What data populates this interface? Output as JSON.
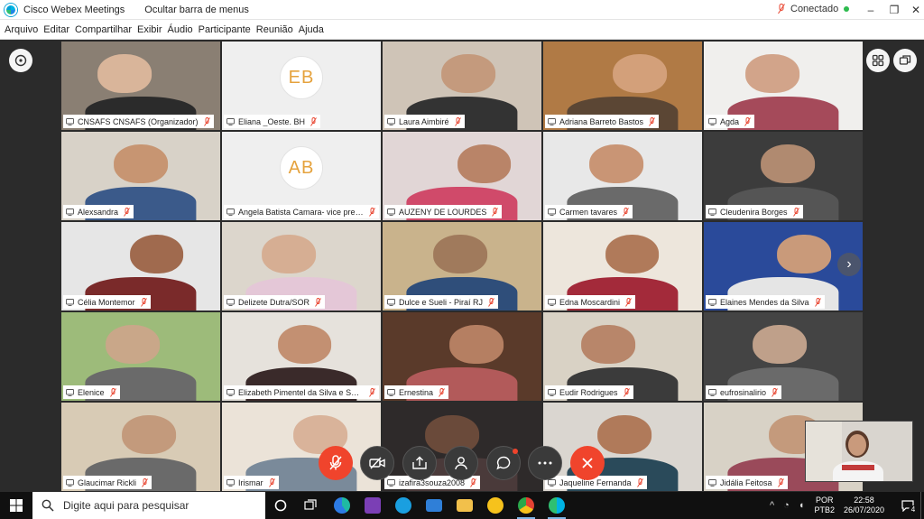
{
  "window": {
    "app_title": "Cisco Webex Meetings",
    "hide_menu_label": "Ocultar barra de menus",
    "status": "Conectado",
    "minimize": "–",
    "restore": "❐",
    "close": "✕"
  },
  "menu": [
    "Arquivo",
    "Editar",
    "Compartilhar",
    "Exibir",
    "Áudio",
    "Participante",
    "Reunião",
    "Ajuda"
  ],
  "participants": [
    {
      "name": "CNSAFS CNSAFS (Organizador)",
      "active": true
    },
    {
      "name": "Eliana _Oeste. BH",
      "initials": "EB"
    },
    {
      "name": "Laura Aimbiré",
      "active": true
    },
    {
      "name": "Adriana Barreto Bastos"
    },
    {
      "name": "Agda"
    },
    {
      "name": "Alexsandra"
    },
    {
      "name": "Angela Batista Camara- vice pres. ...",
      "initials": "AB"
    },
    {
      "name": "AUZENY DE LOURDES"
    },
    {
      "name": "Carmen tavares"
    },
    {
      "name": "Cleudenira Borges"
    },
    {
      "name": "Célia Montemor"
    },
    {
      "name": "Delizete Dutra/SOR"
    },
    {
      "name": "Dulce e Sueli - Piraí RJ"
    },
    {
      "name": "Edna Moscardini"
    },
    {
      "name": "Elaines Mendes da Silva"
    },
    {
      "name": "Elenice"
    },
    {
      "name": "Elizabeth Pimentel da Silva e Souza"
    },
    {
      "name": "Ernestina"
    },
    {
      "name": "Eudir Rodrigues"
    },
    {
      "name": "eufrosinalirio"
    },
    {
      "name": "Glaucimar Rickli"
    },
    {
      "name": "Irismar"
    },
    {
      "name": "izafira3souza2008"
    },
    {
      "name": "Jaqueline Fernanda"
    },
    {
      "name": "Jidália Feitosa"
    }
  ],
  "controls": [
    "mute",
    "video",
    "share",
    "participants",
    "chat",
    "more",
    "leave"
  ],
  "taskbar": {
    "search_placeholder": "Digite aqui para pesquisar",
    "lang_top": "POR",
    "lang_bottom": "PTB2",
    "time": "22:58",
    "date": "26/07/2020",
    "notifications": "4"
  },
  "colors": {
    "accent": "#25a9e0",
    "leave": "#f0442c",
    "muted": "#e8412c",
    "connected": "#2dbb4e"
  }
}
